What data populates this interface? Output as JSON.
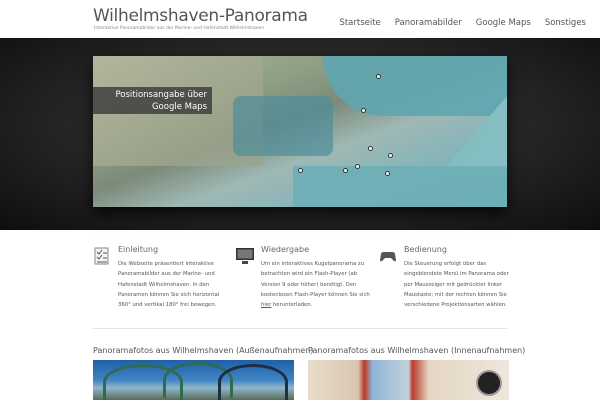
{
  "header": {
    "title": "Wilhelmshaven-Panorama",
    "subtitle": "Interaktive Panoramabilder aus der Marine- und Hafenstadt Wilhelmshaven",
    "nav": [
      {
        "label": "Startseite"
      },
      {
        "label": "Panoramabilder"
      },
      {
        "label": "Google Maps"
      },
      {
        "label": "Sonstiges"
      }
    ]
  },
  "hero": {
    "caption_line1": "Positionsangabe über",
    "caption_line2": "Google Maps"
  },
  "features": [
    {
      "icon": "checklist-icon",
      "title": "Einleitung",
      "text": "Die Webseite präsentiert interaktive Panoramabilder aus der Marine- und Hafenstadt Wilhelmshaven. In den Panoramen können Sie sich horizontal 360° und vertikal 180° frei bewegen."
    },
    {
      "icon": "monitor-icon",
      "title": "Wiedergabe",
      "text_before": "Um ein interaktives Kugelpanorama zu betrachten wird ein Flash-Player (ab Version 9 oder höher) benötigt. Den kostenlosen Flash-Player können Sie sich ",
      "link": "hier",
      "text_after": " herunterladen."
    },
    {
      "icon": "gamepad-icon",
      "title": "Bedienung",
      "text": "Die Steuerung erfolgt über das eingeblendete Menü im Panorama oder per Mauszeiger mit gedrückter linker Maustaste; mit der rechten können Sie verschiedene Projektionsarten wählen."
    }
  ],
  "sections": [
    {
      "title": "Panoramafotos aus Wilhelmshaven (Außenaufnahmen)"
    },
    {
      "title": "Panoramafotos aus Wilhelmshaven (Innenaufnahmen)"
    }
  ]
}
